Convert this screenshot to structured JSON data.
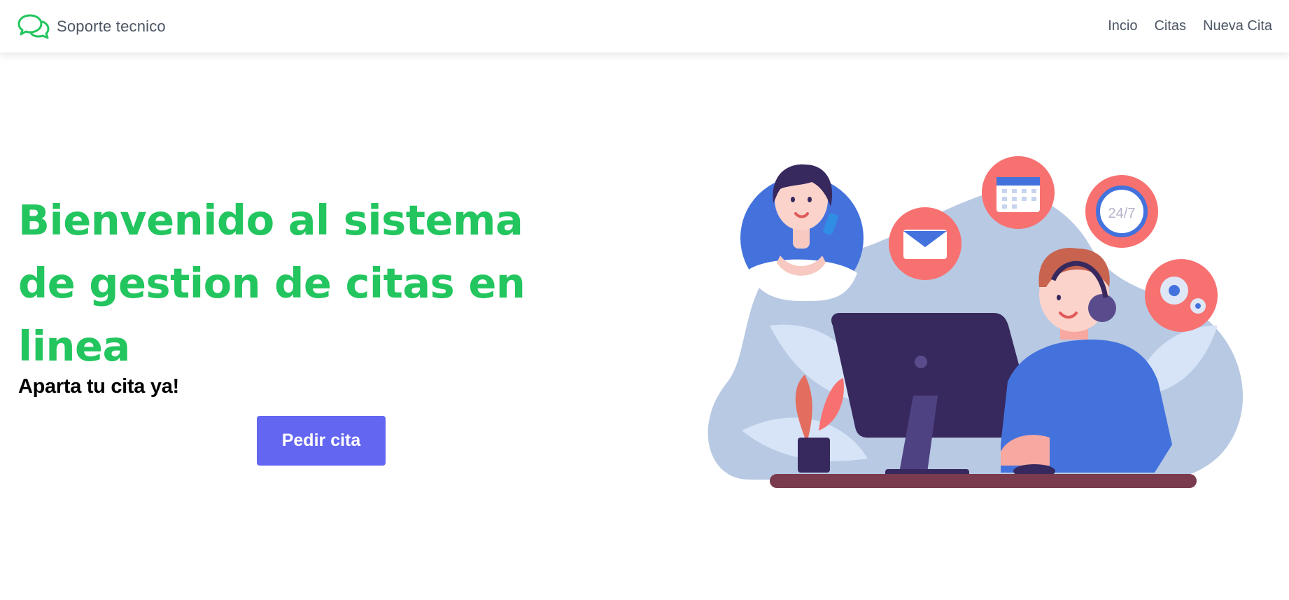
{
  "navbar": {
    "brand": {
      "icon": "chat-bubbles-icon",
      "label": "Soporte tecnico"
    },
    "links": [
      {
        "label": "Incio"
      },
      {
        "label": "Citas"
      },
      {
        "label": "Nueva Cita"
      }
    ]
  },
  "hero": {
    "title": "Bienvenido al sistema de gestion de citas en linea",
    "subtitle": "Aparta tu cita ya!",
    "cta_label": "Pedir cita"
  },
  "illustration": {
    "badge_24_7": "24/7",
    "icons": [
      "envelope-icon",
      "calendar-icon",
      "clock-icon",
      "gears-icon"
    ]
  },
  "colors": {
    "brand_green": "#22c55e",
    "button_indigo": "#6366f1",
    "nav_text": "#4b5563",
    "coral": "#f87171",
    "navy": "#37295e",
    "blue": "#4472dd",
    "blob": "#b8c9e3"
  }
}
